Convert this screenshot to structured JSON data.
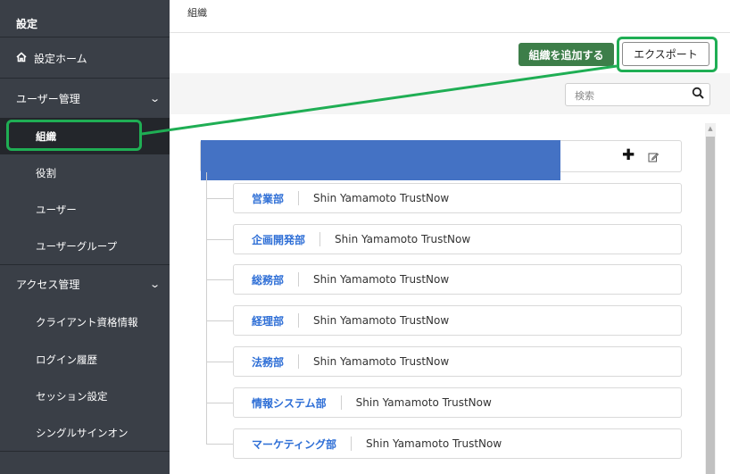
{
  "sidebar": {
    "title": "設定",
    "home": "設定ホーム",
    "sections": [
      {
        "label": "ユーザー管理",
        "items": [
          "組織",
          "役割",
          "ユーザー",
          "ユーザーグループ"
        ]
      },
      {
        "label": "アクセス管理",
        "items": [
          "クライアント資格情報",
          "ログイン履歴",
          "セッション設定",
          "シングルサインオン"
        ]
      }
    ],
    "active_item": "組織"
  },
  "header": {
    "title": "組織"
  },
  "toolbar": {
    "add_label": "組織を追加する",
    "export_label": "エクスポート"
  },
  "search": {
    "placeholder": "検索"
  },
  "tree": {
    "root": {
      "name": ""
    },
    "children": [
      {
        "name": "営業部",
        "owner": "Shin Yamamoto TrustNow"
      },
      {
        "name": "企画開発部",
        "owner": "Shin Yamamoto TrustNow"
      },
      {
        "name": "総務部",
        "owner": "Shin Yamamoto TrustNow"
      },
      {
        "name": "経理部",
        "owner": "Shin Yamamoto TrustNow"
      },
      {
        "name": "法務部",
        "owner": "Shin Yamamoto TrustNow"
      },
      {
        "name": "情報システム部",
        "owner": "Shin Yamamoto TrustNow"
      },
      {
        "name": "マーケティング部",
        "owner": "Shin Yamamoto TrustNow"
      }
    ]
  },
  "colors": {
    "sidebar_bg": "#3a3f47",
    "accent_green": "#3d7e49",
    "callout_green": "#1fae54",
    "link_blue": "#2f6fd6",
    "redaction_blue": "#4472c4"
  }
}
